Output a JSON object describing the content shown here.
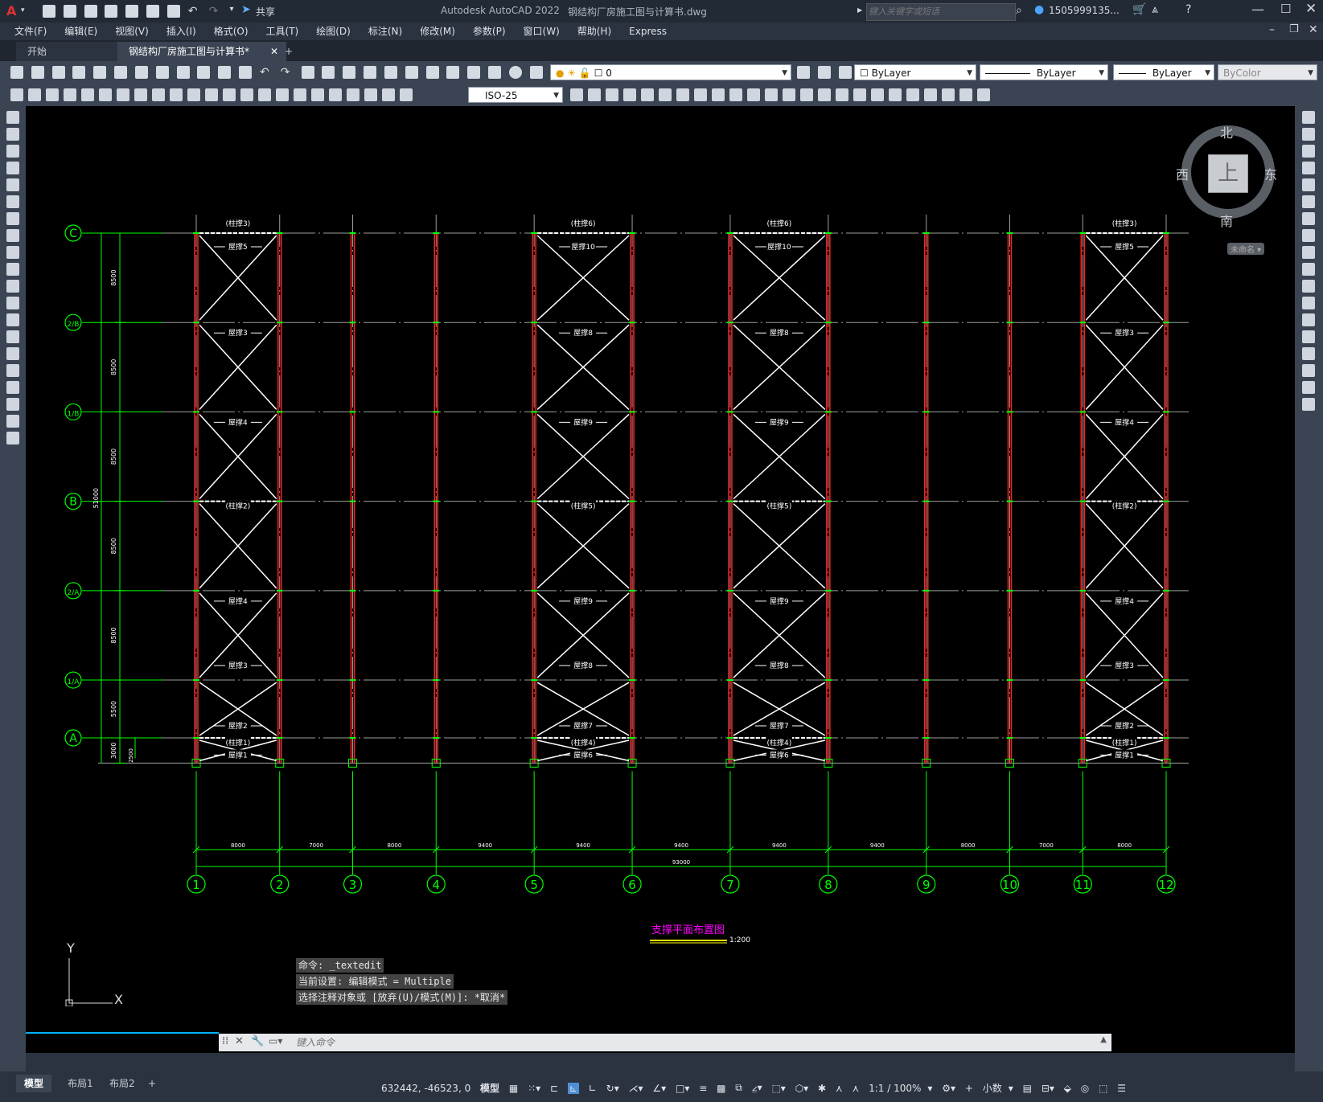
{
  "titlebar": {
    "app_logo": "A",
    "share_label": "共享",
    "app_name": "Autodesk AutoCAD 2022",
    "file_name": "钢结构厂房施工图与计算书.dwg",
    "search_placeholder": "键入关键字或短语",
    "user_name": "1505999135..."
  },
  "menu": [
    "文件(F)",
    "编辑(E)",
    "视图(V)",
    "插入(I)",
    "格式(O)",
    "工具(T)",
    "绘图(D)",
    "标注(N)",
    "修改(M)",
    "参数(P)",
    "窗口(W)",
    "帮助(H)",
    "Express"
  ],
  "tabs": {
    "start": "开始",
    "active": "钢结构厂房施工图与计算书*",
    "add": "+"
  },
  "layer_toolbar": {
    "layer_value": "0",
    "color_value": "ByLayer",
    "linetype_value": "ByLayer",
    "lineweight_value": "ByLayer",
    "plotstyle_value": "ByColor"
  },
  "dim_style": "ISO-25",
  "viewcube": {
    "north": "北",
    "south": "南",
    "east": "东",
    "west": "西",
    "face": "上",
    "wcs": "未命名"
  },
  "ucs": {
    "x": "X",
    "y": "Y"
  },
  "drawing": {
    "row_axes": [
      "C",
      "2/B",
      "1/B",
      "B",
      "2/A",
      "1/A",
      "A"
    ],
    "column_axes": [
      "1",
      "2",
      "3",
      "4",
      "5",
      "6",
      "7",
      "8",
      "9",
      "10",
      "11",
      "12"
    ],
    "bay_dims": [
      "8000",
      "7000",
      "8000",
      "9400",
      "9400",
      "9400",
      "9400",
      "9400",
      "8000",
      "7000",
      "8000"
    ],
    "total_dim": "93000",
    "row_dims": [
      "8500",
      "8500",
      "8500",
      "8500",
      "8500",
      "5500",
      "3000"
    ],
    "total_row_dim": "51000",
    "small_dim": "2500",
    "title": "支撑平面布置图",
    "scale": "1:200",
    "purlin_labels": {
      "bay1": [
        "(柱撑3)",
        "屋撑5",
        "屋撑3",
        "屋撑4",
        "(柱撑2)",
        "屋撑4",
        "屋撑3",
        "屋撑2",
        "(柱撑1)",
        "屋撑1"
      ],
      "bay5": [
        "(柱撑6)",
        "屋撑10",
        "屋撑8",
        "屋撑9",
        "(柱撑5)",
        "屋撑9",
        "屋撑8",
        "屋撑7",
        "(柱撑4)",
        "屋撑6"
      ],
      "bay7": [
        "(柱撑6)",
        "屋撑10",
        "屋撑8",
        "屋撑9",
        "(柱撑5)",
        "屋撑9",
        "屋撑8",
        "屋撑7",
        "(柱撑4)",
        "屋撑6"
      ],
      "bay11": [
        "(柱撑3)",
        "屋撑5",
        "屋撑3",
        "屋撑4",
        "(柱撑2)",
        "屋撑4",
        "屋撑3",
        "屋撑2",
        "(柱撑1)",
        "屋撑1"
      ]
    }
  },
  "command": {
    "history": [
      "命令: _textedit",
      "当前设置: 编辑模式 = Multiple",
      "选择注释对象或 [放弃(U)/模式(M)]: *取消*"
    ],
    "placeholder": "键入命令"
  },
  "layout_tabs": [
    "模型",
    "布局1",
    "布局2",
    "+"
  ],
  "status": {
    "coords": "632442, -46523, 0",
    "model": "模型",
    "scale": "1:1 / 100%",
    "units": "小数"
  },
  "colors": {
    "grid_green": "#00ff00",
    "column_red": "#ff2020",
    "brace_white": "#ffffff",
    "title_magenta": "#ff00ff",
    "title_underline": "#ffff00"
  }
}
